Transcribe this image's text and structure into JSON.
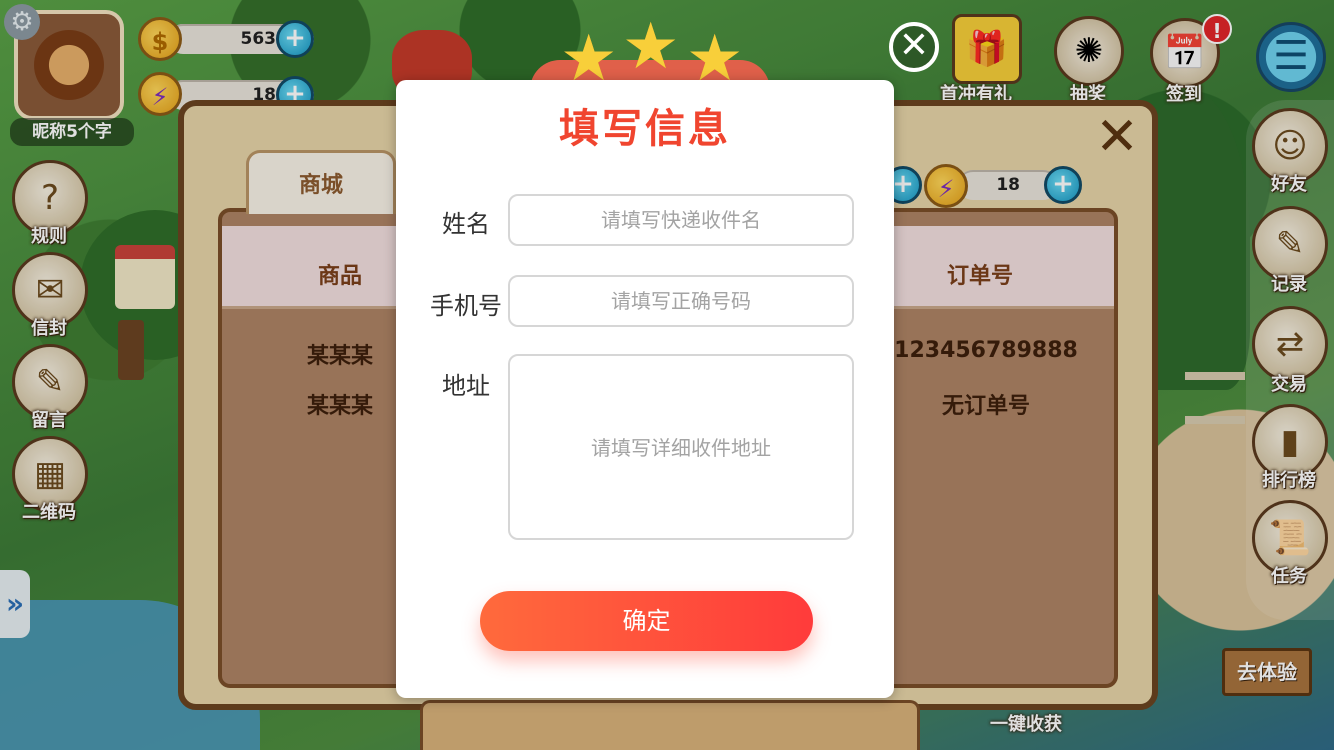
{
  "profile": {
    "nickname": "昵称5个字"
  },
  "resources": {
    "coins": "563",
    "gems": "18",
    "gems_panel": "18"
  },
  "left_menu": [
    {
      "label": "规则",
      "icon": "rules-icon"
    },
    {
      "label": "信封",
      "icon": "envelope-icon"
    },
    {
      "label": "留言",
      "icon": "message-icon"
    },
    {
      "label": "二维码",
      "icon": "qrcode-icon"
    }
  ],
  "top_menu": {
    "gift": "首冲有礼",
    "lottery": "抽奖",
    "signin": "签到",
    "badge": "!"
  },
  "right_menu": [
    {
      "label": "好友",
      "icon": "friends-icon"
    },
    {
      "label": "记录",
      "icon": "record-icon"
    },
    {
      "label": "交易",
      "icon": "trade-icon"
    },
    {
      "label": "排行榜",
      "icon": "leaderboard-icon"
    },
    {
      "label": "任务",
      "icon": "task-icon"
    }
  ],
  "shop_panel": {
    "tab": "商城",
    "columns": [
      "商品",
      "订单号"
    ],
    "rows": [
      {
        "product": "某某某",
        "order": "123456789888"
      },
      {
        "product": "某某某",
        "order": "无订单号"
      }
    ]
  },
  "modal": {
    "title": "填写信息",
    "fields": {
      "name": {
        "label": "姓名",
        "placeholder": "请填写快递收件名"
      },
      "phone": {
        "label": "手机号",
        "placeholder": "请填写正确号码"
      },
      "address": {
        "label": "地址",
        "placeholder": "请填写详细收件地址"
      }
    },
    "confirm": "确定"
  },
  "bottom": {
    "experience": "去体验",
    "harvest": "一键收获"
  },
  "colors": {
    "title_red": "#f0452f",
    "button_start": "#ff6a3c",
    "button_end": "#ff3b3b",
    "panel_brown": "#6a4420"
  }
}
